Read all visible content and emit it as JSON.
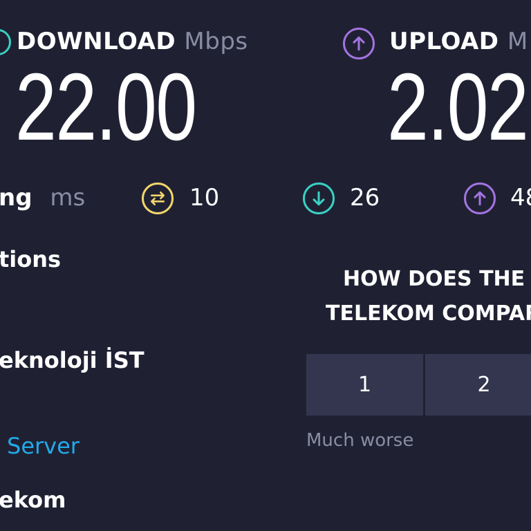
{
  "download": {
    "label": "DOWNLOAD",
    "unit": "Mbps",
    "value": "22.00",
    "color": "#3ad1c3"
  },
  "upload": {
    "label": "UPLOAD",
    "unit_partial": "M",
    "value": "2.02",
    "color": "#a374e0"
  },
  "ping": {
    "label_partial": "ng",
    "unit": "ms",
    "jitter_value": "10",
    "download_value": "26",
    "upload_value_partial": "48",
    "jitter_color": "#f2d56b",
    "download_color": "#3ad1c3",
    "upload_color": "#a374e0"
  },
  "connections": {
    "heading_partial": "tions",
    "server_name_partial": "eknoloji İST",
    "divider_char": "|",
    "change_server_partial": "Server",
    "provider_partial": "ekom"
  },
  "survey": {
    "question_line1": "HOW DOES THE",
    "question_line2": "TELEKOM COMPAR",
    "options": [
      "1",
      "2"
    ],
    "low_label": "Much worse"
  },
  "colors": {
    "background": "#1f2133",
    "button": "#33364e",
    "link": "#23a9e8",
    "muted": "#8a8ca3"
  }
}
